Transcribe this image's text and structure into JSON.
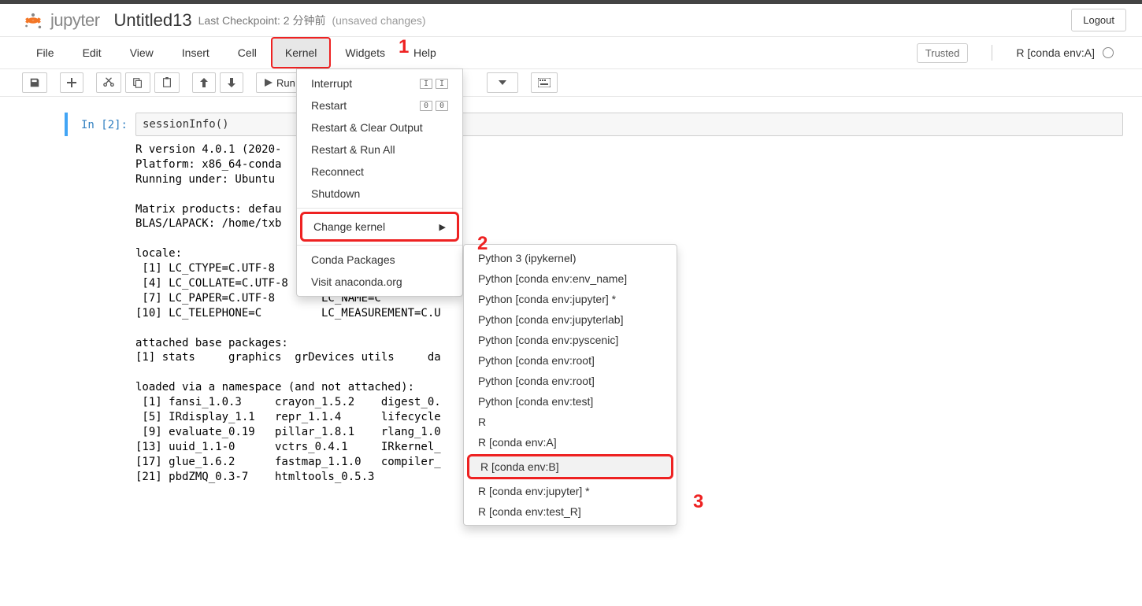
{
  "header": {
    "logo_text": "jupyter",
    "title": "Untitled13",
    "checkpoint": "Last Checkpoint: 2 分钟前",
    "unsaved": "(unsaved changes)",
    "logout": "Logout"
  },
  "menubar": {
    "items": [
      "File",
      "Edit",
      "View",
      "Insert",
      "Cell",
      "Kernel",
      "Widgets",
      "Help"
    ],
    "active_index": 5,
    "trusted": "Trusted",
    "kernel_name": "R [conda env:A]"
  },
  "toolbar": {
    "run_label": "Run"
  },
  "kernel_menu": {
    "items": [
      {
        "label": "Interrupt",
        "kbd": [
          "I",
          "I"
        ]
      },
      {
        "label": "Restart",
        "kbd": [
          "0",
          "0"
        ]
      },
      {
        "label": "Restart & Clear Output"
      },
      {
        "label": "Restart & Run All"
      },
      {
        "label": "Reconnect"
      },
      {
        "label": "Shutdown"
      },
      {
        "sep": true
      },
      {
        "label": "Change kernel",
        "submenu": true,
        "highlight": true
      },
      {
        "sep": true
      },
      {
        "label": "Conda Packages"
      },
      {
        "label": "Visit anaconda.org"
      }
    ]
  },
  "change_kernel_submenu": {
    "items": [
      {
        "label": "Python 3 (ipykernel)"
      },
      {
        "label": "Python [conda env:env_name]"
      },
      {
        "label": "Python [conda env:jupyter] *"
      },
      {
        "label": "Python [conda env:jupyterlab]"
      },
      {
        "label": "Python [conda env:pyscenic]"
      },
      {
        "label": "Python [conda env:root]"
      },
      {
        "label": "Python [conda env:root]"
      },
      {
        "label": "Python [conda env:test]"
      },
      {
        "label": "R"
      },
      {
        "label": "R [conda env:A]"
      },
      {
        "label": "R [conda env:B]",
        "highlight": true
      },
      {
        "label": "R [conda env:jupyter] *"
      },
      {
        "label": "R [conda env:test_R]"
      }
    ]
  },
  "annotations": {
    "a1": "1",
    "a2": "2",
    "a3": "3"
  },
  "cell": {
    "prompt": "In  [2]:",
    "input": "sessionInfo()",
    "output": "R version 4.0.1 (2020-\nPlatform: x86_64-conda\nRunning under: Ubuntu \n\nMatrix products: defau\nBLAS/LAPACK: /home/txb\n\nlocale:\n [1] LC_CTYPE=C.UTF-8\n [4] LC_COLLATE=C.UTF-8     LC_MONETARY=C.UTF-\n [7] LC_PAPER=C.UTF-8       LC_NAME=C\n[10] LC_TELEPHONE=C         LC_MEASUREMENT=C.U\n\nattached base packages:\n[1] stats     graphics  grDevices utils     da\n\nloaded via a namespace (and not attached):\n [1] fansi_1.0.3     crayon_1.5.2    digest_0.\n [5] IRdisplay_1.1   repr_1.1.4      lifecycle\n [9] evaluate_0.19   pillar_1.8.1    rlang_1.0\n[13] uuid_1.1-0      vctrs_0.4.1     IRkernel_\n[17] glue_1.6.2      fastmap_1.1.0   compiler_\n[21] pbdZMQ_0.3-7    htmltools_0.5.3"
  }
}
